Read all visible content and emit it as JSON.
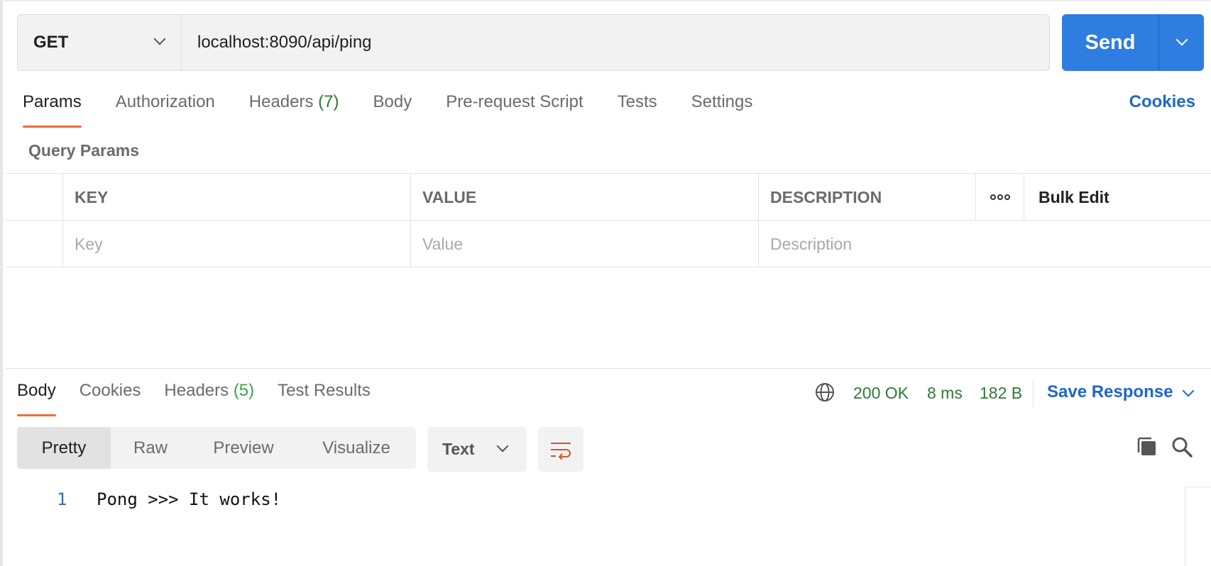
{
  "request": {
    "method": "GET",
    "url": "localhost:8090/api/ping",
    "send_label": "Send"
  },
  "request_tabs": {
    "params": "Params",
    "authorization": "Authorization",
    "headers": "Headers",
    "headers_count": "(7)",
    "body": "Body",
    "prerequest": "Pre-request Script",
    "tests": "Tests",
    "settings": "Settings",
    "cookies": "Cookies"
  },
  "query_params": {
    "title": "Query Params",
    "columns": {
      "key": "KEY",
      "value": "VALUE",
      "description": "DESCRIPTION",
      "bulk_edit": "Bulk Edit"
    },
    "placeholders": {
      "key": "Key",
      "value": "Value",
      "description": "Description"
    }
  },
  "response_tabs": {
    "body": "Body",
    "cookies": "Cookies",
    "headers": "Headers",
    "headers_count": "(5)",
    "test_results": "Test Results"
  },
  "response_status": {
    "status": "200 OK",
    "time": "8 ms",
    "size": "182 B",
    "save_response": "Save Response"
  },
  "view_modes": [
    "Pretty",
    "Raw",
    "Preview",
    "Visualize"
  ],
  "format": "Text",
  "response_body": {
    "line_number": "1",
    "line": "Pong >>> It works!"
  },
  "colors": {
    "accent": "#2e7de1",
    "link": "#1f66c9",
    "active_tab_underline": "#f26b3a",
    "status_green": "#2c7a36"
  },
  "icons": [
    "chevron-down-icon",
    "globe-icon",
    "wrap-lines-icon",
    "copy-icon",
    "search-icon",
    "more-icon"
  ]
}
